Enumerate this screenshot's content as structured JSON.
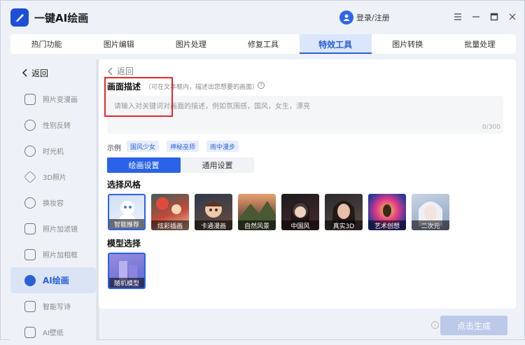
{
  "app": {
    "title": "一键AI绘画"
  },
  "header": {
    "login_label": "登录/注册"
  },
  "tabs": [
    {
      "label": "热门功能",
      "active": false
    },
    {
      "label": "图片编辑",
      "active": false
    },
    {
      "label": "图片处理",
      "active": false
    },
    {
      "label": "修复工具",
      "active": false
    },
    {
      "label": "特效工具",
      "active": true
    },
    {
      "label": "图片转换",
      "active": false
    },
    {
      "label": "批量处理",
      "active": false
    }
  ],
  "sidebar": {
    "back_label": "返回",
    "items": [
      {
        "label": "照片变漫画",
        "icon": "cartoon-face-icon"
      },
      {
        "label": "性别反转",
        "icon": "gender-icon"
      },
      {
        "label": "时光机",
        "icon": "clock-icon"
      },
      {
        "label": "3D照片",
        "icon": "layers-icon"
      },
      {
        "label": "换妆容",
        "icon": "makeup-icon"
      },
      {
        "label": "照片加滤镜",
        "icon": "filter-icon"
      },
      {
        "label": "照片加相框",
        "icon": "frame-icon"
      },
      {
        "label": "AI绘画",
        "icon": "ai-paint-icon",
        "active": true
      },
      {
        "label": "智能写诗",
        "icon": "ai-poem-icon"
      },
      {
        "label": "AI壁纸",
        "icon": "ai-wallpaper-icon"
      }
    ]
  },
  "main": {
    "back_label": "返回",
    "desc_title": "画面描述",
    "desc_hint": "（可在文本框内，描述出您想要的画面）",
    "prompt_placeholder": "请输入对关键词对画面的描述，例如氛围感，国风，女生，漂亮",
    "char_count": "0/300",
    "examples_label": "示例",
    "examples": [
      "国风少女",
      "神秘巫师",
      "雨中漫步"
    ],
    "settings_tabs": [
      {
        "label": "绘画设置",
        "active": true
      },
      {
        "label": "通用设置",
        "active": false
      }
    ],
    "style_title": "选择风格",
    "styles": [
      {
        "label": "智能推荐",
        "selected": true
      },
      {
        "label": "炫彩插画"
      },
      {
        "label": "卡通漫画"
      },
      {
        "label": "自然风景"
      },
      {
        "label": "中国风"
      },
      {
        "label": "真实3D"
      },
      {
        "label": "艺术创想"
      },
      {
        "label": "二次元"
      }
    ],
    "model_title": "模型选择",
    "models": [
      {
        "label": "随机模型",
        "selected": true
      }
    ]
  },
  "footer": {
    "generate_label": "点击生成"
  },
  "colors": {
    "accent": "#2a62e8",
    "highlight": "#e0282e"
  }
}
